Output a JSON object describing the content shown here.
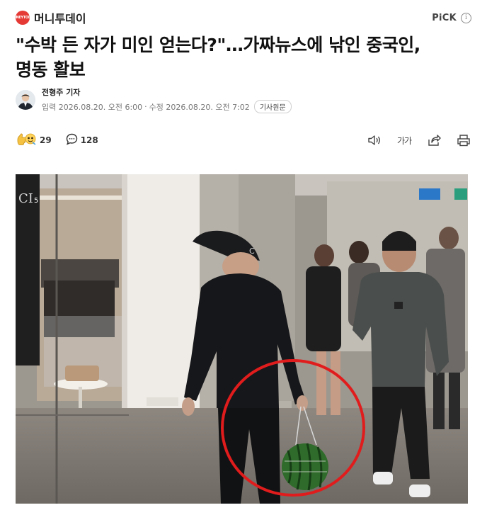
{
  "header": {
    "logo_text": "MONEYTODAY",
    "brand": "머니투데이",
    "pick_label": "PiCK",
    "info_icon": "i"
  },
  "article": {
    "headline_line1": "\"수박 든 자가 미인 얻는다?\"…가짜뉴스에 낚인 중국인,",
    "headline_line2": "명동 활보",
    "reporter": "전형주 기자",
    "published": "입력 2026.08.20. 오전 6:00",
    "updated": "수정 2026.08.20. 오전 7:02",
    "separator": "·",
    "original_label": "기사원문"
  },
  "actions": {
    "reaction_count": "29",
    "comment_count": "128",
    "font_size_label": "가가"
  },
  "photo": {
    "store_sign_fragment": "CI",
    "floor_number": "5",
    "cap_letter": "C"
  },
  "colors": {
    "brand_red": "#e53935",
    "circle_red": "#e11c1c",
    "text_dark": "#111111",
    "text_meta": "#777777"
  },
  "icons": [
    "info-icon",
    "reaction-emoji-icon",
    "comment-icon",
    "audio-icon",
    "font-size-icon",
    "share-icon",
    "print-icon",
    "avatar"
  ]
}
